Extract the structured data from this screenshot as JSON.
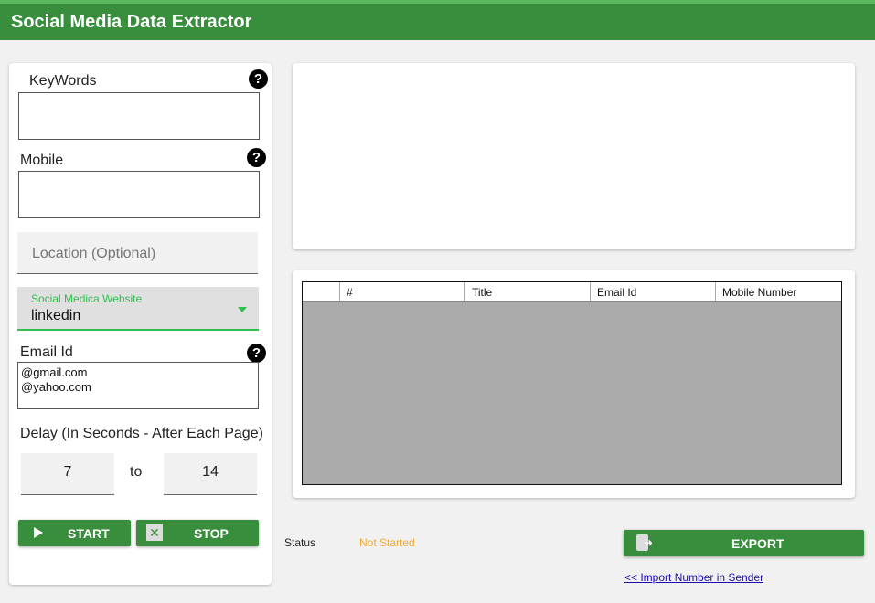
{
  "app": {
    "title": "Social Media Data Extractor"
  },
  "form": {
    "keywords_label": "KeyWords",
    "keywords_value": "",
    "mobile_label": "Mobile",
    "mobile_value": "",
    "location_placeholder": "Location (Optional)",
    "website_label": "Social Medica Website",
    "website_value": "linkedin",
    "email_label": "Email Id",
    "email_lines": [
      "@gmail.com",
      "@yahoo.com"
    ],
    "delay_label": "Delay (In Seconds - After Each Page)",
    "delay_from": "7",
    "delay_to_label": "to",
    "delay_to": "14",
    "help_glyph": "?"
  },
  "buttons": {
    "start": "START",
    "stop": "STOP",
    "stop_glyph": "✕",
    "export": "EXPORT"
  },
  "table": {
    "columns": [
      "",
      "#",
      "Title",
      "Email Id",
      "Mobile Number"
    ]
  },
  "status": {
    "label": "Status",
    "value": "Not Started"
  },
  "links": {
    "import": "<< Import Number in Sender"
  },
  "icons": {
    "help": "question-circle-icon",
    "start": "play-icon",
    "stop": "close-box-icon",
    "export": "export-icon",
    "dropdown": "caret-down-icon"
  },
  "colors": {
    "primary": "#388e3c",
    "accent": "#2fbf4f",
    "status": "#f0a830"
  }
}
